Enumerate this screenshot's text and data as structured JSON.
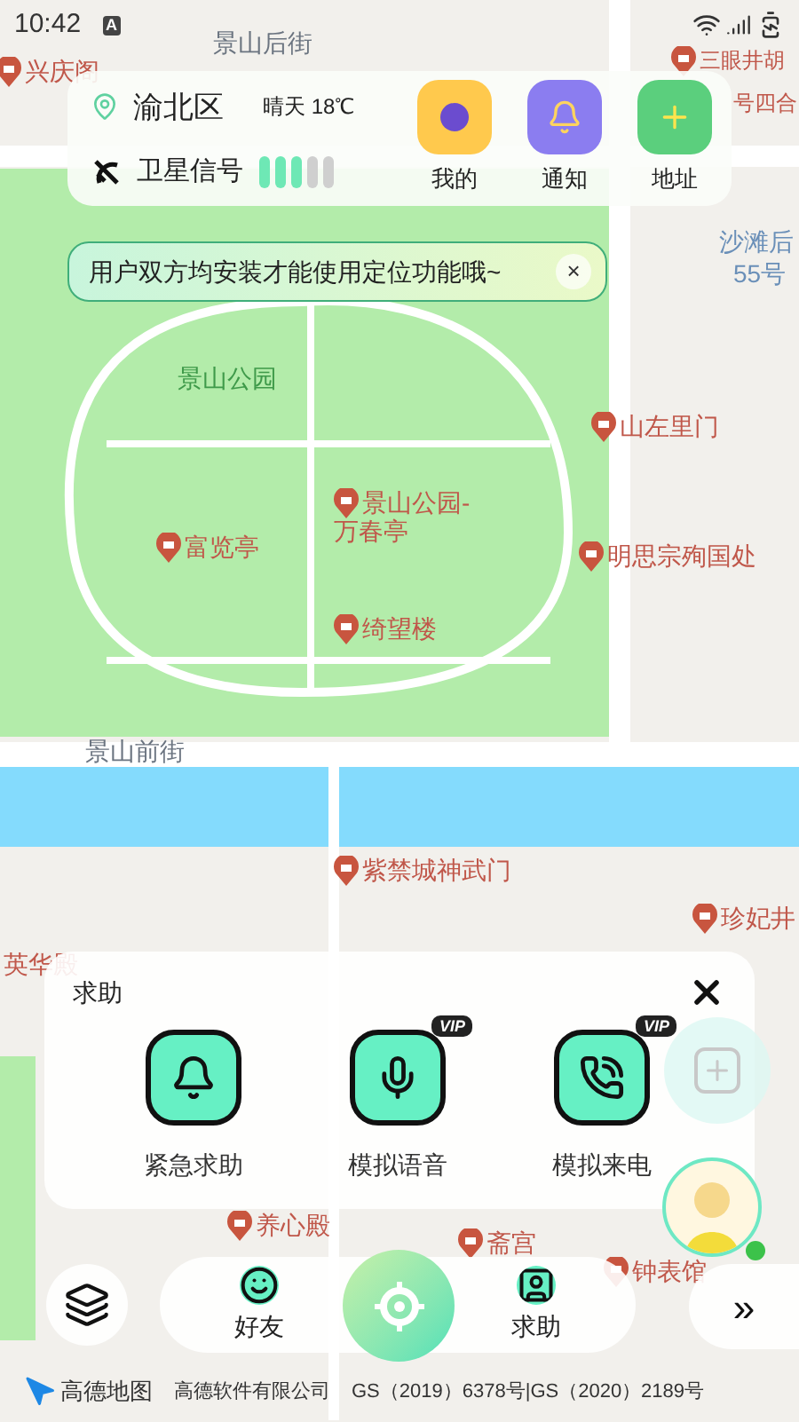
{
  "status_bar": {
    "time": "10:42",
    "badge": "A"
  },
  "map_labels": [
    {
      "text": "景山后街",
      "kind": "street"
    },
    {
      "text": "兴庆阁",
      "kind": "poi"
    },
    {
      "text": "三眼井胡",
      "kind": "poi"
    },
    {
      "text": "号四合",
      "kind": "label"
    },
    {
      "text": "沙滩后",
      "kind": "area"
    },
    {
      "text": "55号",
      "kind": "area"
    },
    {
      "text": "景山公园",
      "kind": "park"
    },
    {
      "text": "山左里门",
      "kind": "poi"
    },
    {
      "text": "景山公园-",
      "kind": "poi"
    },
    {
      "text": "万春亭",
      "kind": "label"
    },
    {
      "text": "富览亭",
      "kind": "poi"
    },
    {
      "text": "明思宗殉国处",
      "kind": "poi"
    },
    {
      "text": "绮望楼",
      "kind": "poi"
    },
    {
      "text": "景山前街",
      "kind": "street"
    },
    {
      "text": "紫禁城神武门",
      "kind": "poi"
    },
    {
      "text": "珍妃井",
      "kind": "poi"
    },
    {
      "text": "英华殿",
      "kind": "label"
    },
    {
      "text": "养心殿",
      "kind": "poi"
    },
    {
      "text": "斋宫",
      "kind": "poi"
    },
    {
      "text": "钟表馆",
      "kind": "poi"
    }
  ],
  "info_card": {
    "district": "渝北区",
    "weather": "晴天 18℃",
    "signal_label": "卫星信号"
  },
  "shortcuts": [
    {
      "label": "我的",
      "kind": "profile"
    },
    {
      "label": "通知",
      "kind": "notice"
    },
    {
      "label": "地址",
      "kind": "address"
    }
  ],
  "toast": {
    "text": "用户双方均安装才能使用定位功能哦~",
    "close": "×"
  },
  "help_panel": {
    "title": "求助",
    "actions": [
      {
        "label": "紧急求助",
        "kind": "alarm"
      },
      {
        "label": "模拟语音",
        "kind": "voice",
        "badge": "VIP"
      },
      {
        "label": "模拟来电",
        "kind": "call",
        "badge": "VIP"
      }
    ]
  },
  "bottom_bar": {
    "items": [
      {
        "label": "好友",
        "kind": "friends"
      },
      {
        "label": "求助",
        "kind": "help"
      }
    ],
    "more": "»"
  },
  "footer": {
    "logo": "高德地图",
    "company": "高德软件有限公司",
    "license": "GS（2019）6378号|GS（2020）2189号"
  }
}
